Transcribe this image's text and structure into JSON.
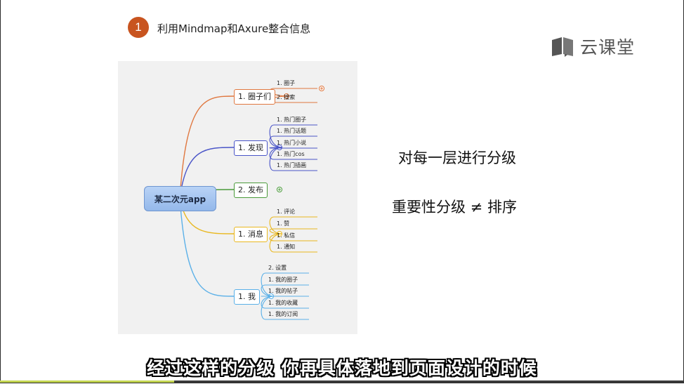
{
  "slide": {
    "step_number": "1",
    "step_title": "利用Mindmap和Axure整合信息",
    "logo_text": "云课堂",
    "annotation_1": "对每一层进行分级",
    "annotation_2": "重要性分级 ≠ 排序",
    "subtitle": "经过这样的分级 你再具体落地到页面设计的时候"
  },
  "mindmap": {
    "central": "某二次元app",
    "branches": [
      {
        "label": "1. 圈子们",
        "color": "#e07840",
        "leaves": [
          "1. 圈子",
          "2. 搜索"
        ]
      },
      {
        "label": "1. 发现",
        "color": "#4a55c8",
        "leaves": [
          "1. 热门圈子",
          "1. 热门话题",
          "1. 热门小说",
          "1. 热门cos",
          "1. 热门插画"
        ]
      },
      {
        "label": "2. 发布",
        "color": "#4a9a3a",
        "leaves": []
      },
      {
        "label": "1. 消息",
        "color": "#e9b820",
        "leaves": [
          "1. 评论",
          "1. 赞",
          "1. 私信",
          "1. 通知"
        ]
      },
      {
        "label": "1. 我",
        "color": "#5ab0e8",
        "leaves": [
          "2. 设置",
          "1. 我的圈子",
          "1. 我的帖子",
          "1. 我的收藏",
          "1. 我的订阅"
        ]
      }
    ]
  },
  "player": {
    "progress": 0.255,
    "progress_color": "#c2d44f"
  }
}
